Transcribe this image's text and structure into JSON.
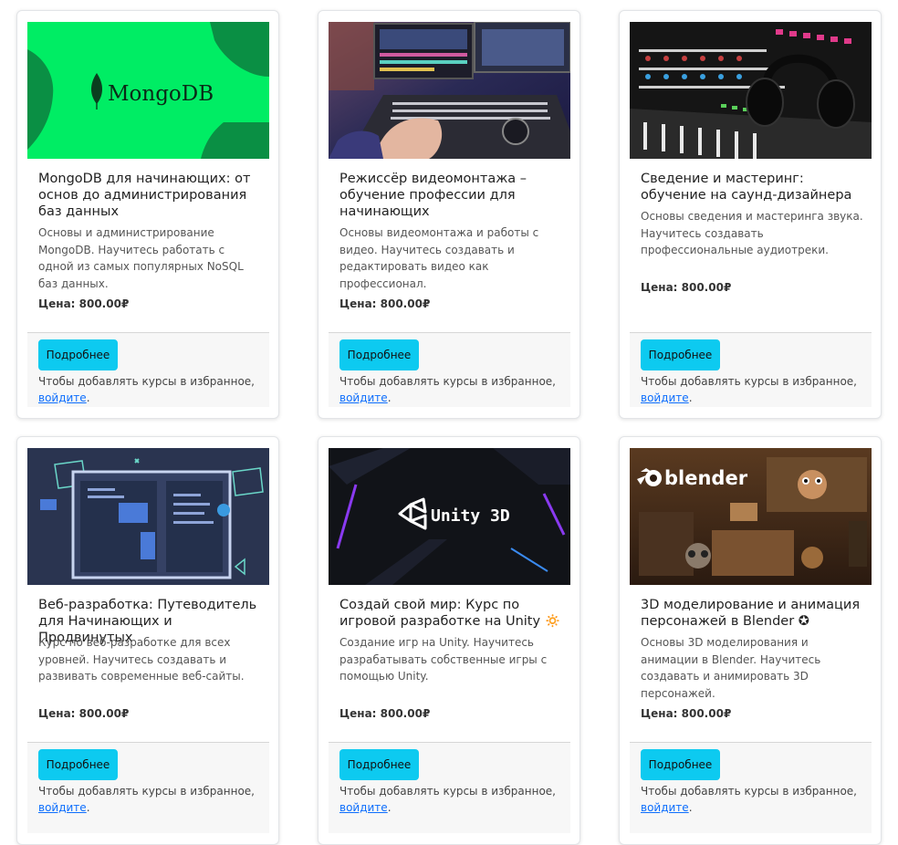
{
  "courses": [
    {
      "title": "MongoDB для начинающих: от основ до администрирования баз данных",
      "description": "Основы и администрирование MongoDB. Научитесь работать с одной из самых популярных NoSQL баз данных.",
      "price": "Цена: 800.00₽",
      "button": "Подробнее",
      "favorites_text": "Чтобы добавлять курсы в избранное,",
      "login_link": "войдите",
      "image_text": "MongoDB"
    },
    {
      "title": "Режиссёр видеомонтажа – обучение профессии для начинающих",
      "description": "Основы видеомонтажа и работы с видео. Научитесь создавать и редактировать видео как профессионал.",
      "price": "Цена: 800.00₽",
      "button": "Подробнее",
      "favorites_text": "Чтобы добавлять курсы в избранное,",
      "login_link": "войдите"
    },
    {
      "title": "Сведение и мастеринг: обучение на саунд-дизайнера",
      "description": "Основы сведения и мастеринга звука. Научитесь создавать профессиональные аудиотреки.",
      "price": "Цена: 800.00₽",
      "button": "Подробнее",
      "favorites_text": "Чтобы добавлять курсы в избранное,",
      "login_link": "войдите"
    },
    {
      "title": "Веб-разработка: Путеводитель для Начинающих и Продвинутых",
      "description": "Курс по веб-разработке для всех уровней. Научитесь создавать и развивать современные веб-сайты.",
      "price": "Цена: 800.00₽",
      "button": "Подробнее",
      "favorites_text": "Чтобы добавлять курсы в избранное,",
      "login_link": "войдите"
    },
    {
      "title": "Создай свой мир: Курс по игровой разработке на Unity 🔅",
      "description": "Создание игр на Unity. Научитесь разрабатывать собственные игры с помощью Unity.",
      "price": "Цена: 800.00₽",
      "button": "Подробнее",
      "favorites_text": "Чтобы добавлять курсы в избранное,",
      "login_link": "войдите",
      "image_text": "Unity 3D"
    },
    {
      "title": "3D моделирование и анимация персонажей в Blender ✪",
      "description": "Основы 3D моделирования и анимации в Blender. Научитесь создавать и анимировать 3D персонажей.",
      "price": "Цена: 800.00₽",
      "button": "Подробнее",
      "favorites_text": "Чтобы добавлять курсы в избранное,",
      "login_link": "войдите",
      "image_text": "blender"
    }
  ],
  "colors": {
    "button": "#0dcaf0",
    "link": "#0d6efd",
    "mongo_green": "#00ed64"
  }
}
